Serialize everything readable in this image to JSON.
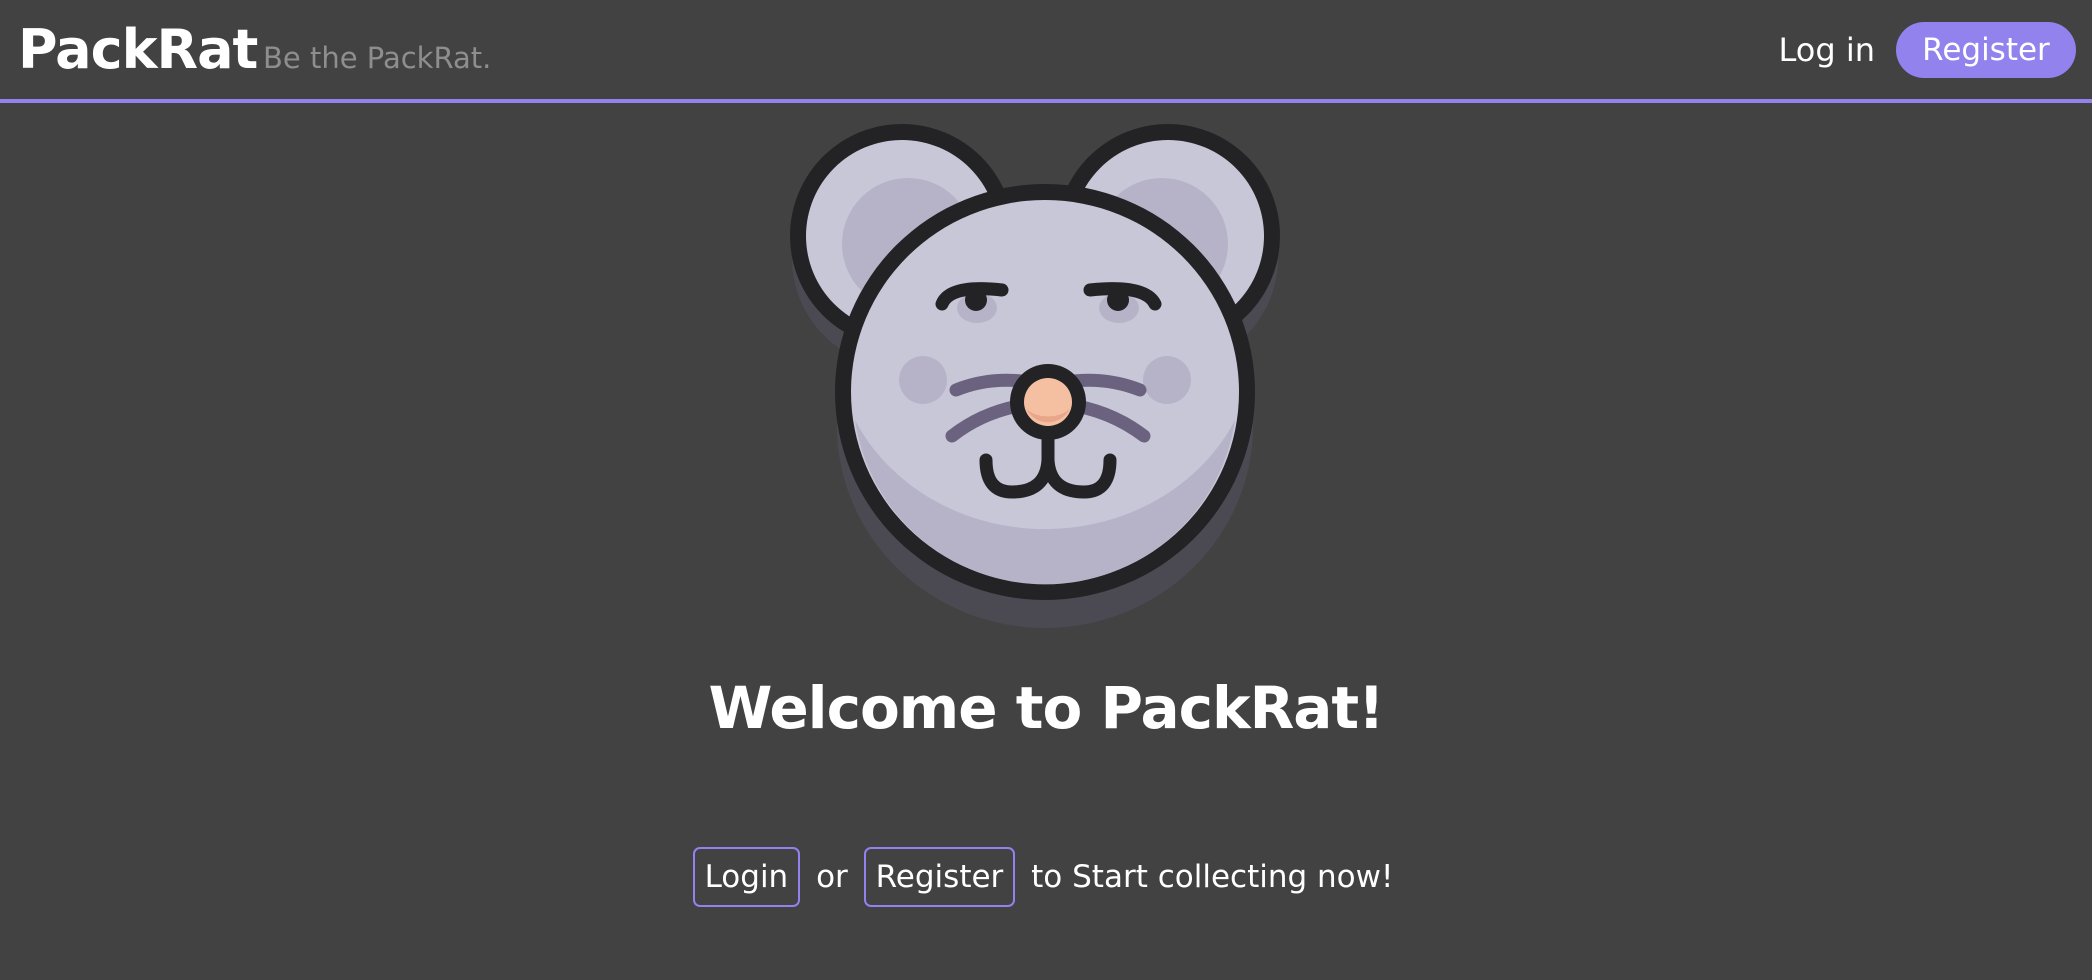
{
  "header": {
    "brand": "PackRat",
    "tagline": "Be the PackRat.",
    "login_label": "Log in",
    "register_label": "Register"
  },
  "hero": {
    "logo_icon": "rat-face-icon",
    "title": "Welcome to PackRat!"
  },
  "cta": {
    "login_label": "Login",
    "or_text": "or",
    "register_label": "Register",
    "suffix_text": "to Start collecting now!"
  },
  "colors": {
    "background": "#424242",
    "accent": "#9182ed",
    "text": "#ffffff",
    "muted": "#8e8e8e"
  }
}
